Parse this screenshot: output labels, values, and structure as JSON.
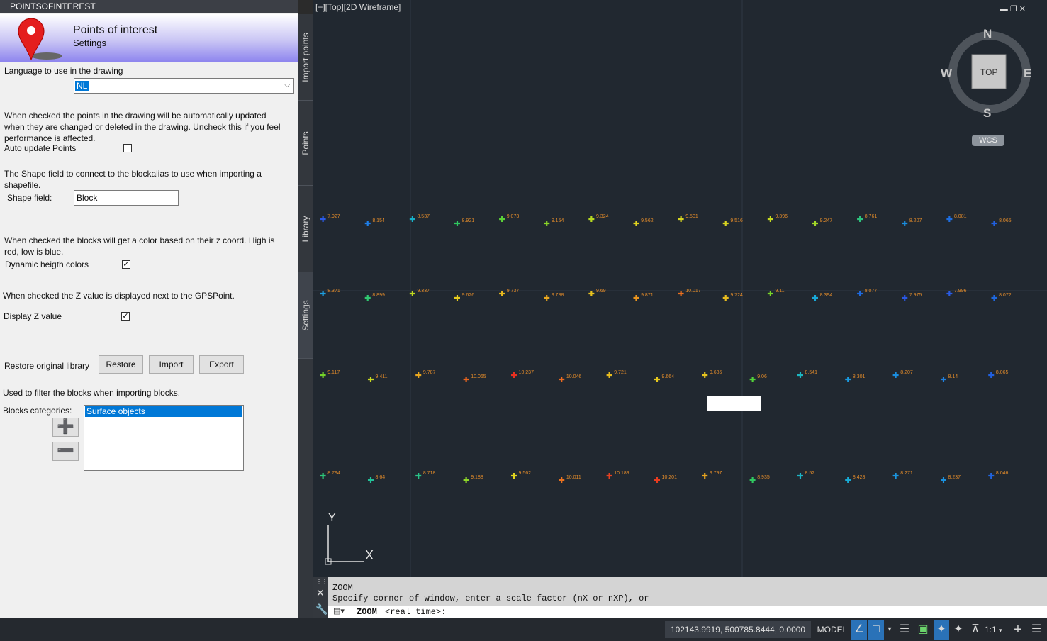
{
  "palette": {
    "title": "POINTSOFINTEREST",
    "header_title": "Points of interest",
    "header_subtitle": "Settings",
    "language_label": "Language to use in the drawing",
    "language_value": "NL",
    "auto_update_desc": "When checked the points in the drawing will be automatically updated when they are changed or deleted in the drawing. Uncheck this if you feel performance is affected.",
    "auto_update_label": "Auto update Points",
    "auto_update_checked": false,
    "shape_desc": "The Shape field to connect to the blockalias to use when importing a shapefile.",
    "shape_label": "Shape field:",
    "shape_value": "Block",
    "dyn_desc": "When checked the blocks will get a color based on their z coord. High is red, low is blue.",
    "dyn_label": "Dynamic heigth colors",
    "dyn_checked": true,
    "z_desc": "When checked the Z value is displayed next to the GPSPoint.",
    "z_label": "Display Z value",
    "z_checked": true,
    "restore_label": "Restore original library",
    "restore_btn": "Restore",
    "import_btn": "Import",
    "export_btn": "Export",
    "filter_desc": "Used to filter the blocks when importing blocks.",
    "categories_label": "Blocks categories:",
    "categories": [
      "Surface objects"
    ],
    "add_icon": "plus-icon",
    "remove_icon": "minus-icon"
  },
  "tabs": [
    "Import points",
    "Points",
    "Library",
    "Settings"
  ],
  "viewport": {
    "label": "[−][Top][2D Wireframe]",
    "viewcube": {
      "n": "N",
      "s": "S",
      "e": "E",
      "w": "W",
      "top": "TOP",
      "wcs": "WCS"
    },
    "ucs": {
      "x": "X",
      "y": "Y"
    }
  },
  "points": [
    {
      "z": "7.927",
      "c": "#2a5ae8"
    },
    {
      "z": "8.154",
      "c": "#1e7ee8"
    },
    {
      "z": "8.537",
      "c": "#17b0c8"
    },
    {
      "z": "8.921",
      "c": "#2fc860"
    },
    {
      "z": "9.073",
      "c": "#5bd238"
    },
    {
      "z": "9.154",
      "c": "#8bd828"
    },
    {
      "z": "9.324",
      "c": "#b6d820"
    },
    {
      "z": "9.562",
      "c": "#e0d41e"
    },
    {
      "z": "9.501",
      "c": "#d6d420"
    },
    {
      "z": "9.516",
      "c": "#d8d420"
    },
    {
      "z": "9.396",
      "c": "#c4d820"
    },
    {
      "z": "9.247",
      "c": "#a2d828"
    },
    {
      "z": "8.761",
      "c": "#2dc27c"
    },
    {
      "z": "8.207",
      "c": "#1a8ee0"
    },
    {
      "z": "8.081",
      "c": "#1e6ee0"
    },
    {
      "z": "8.065",
      "c": "#2060e0"
    },
    {
      "z": "8.371",
      "c": "#1ea0e0"
    },
    {
      "z": "8.899",
      "c": "#30c870"
    },
    {
      "z": "9.337",
      "c": "#c0d820"
    },
    {
      "z": "9.626",
      "c": "#e6cc1e"
    },
    {
      "z": "9.737",
      "c": "#e8b81e"
    },
    {
      "z": "9.788",
      "c": "#eaa81e"
    },
    {
      "z": "9.69",
      "c": "#e8c21e"
    },
    {
      "z": "9.871",
      "c": "#ec961e"
    },
    {
      "z": "10.017",
      "c": "#ec701e"
    },
    {
      "z": "9.724",
      "c": "#e8bc1e"
    },
    {
      "z": "9.11",
      "c": "#78d428"
    },
    {
      "z": "8.394",
      "c": "#18a8d8"
    },
    {
      "z": "8.077",
      "c": "#1e6ae0"
    },
    {
      "z": "7.975",
      "c": "#2a58e6"
    },
    {
      "z": "7.996",
      "c": "#2a5ce6"
    },
    {
      "z": "8.072",
      "c": "#1e68e0"
    },
    {
      "z": "9.117",
      "c": "#76d42a"
    },
    {
      "z": "9.411",
      "c": "#c8d820"
    },
    {
      "z": "9.787",
      "c": "#eaa81e"
    },
    {
      "z": "10.065",
      "c": "#ec661e"
    },
    {
      "z": "10.237",
      "c": "#e83020"
    },
    {
      "z": "10.046",
      "c": "#ec6a1e"
    },
    {
      "z": "9.721",
      "c": "#e8bc1e"
    },
    {
      "z": "9.664",
      "c": "#e6c81e"
    },
    {
      "z": "9.685",
      "c": "#e6c41e"
    },
    {
      "z": "9.06",
      "c": "#52d23a"
    },
    {
      "z": "8.541",
      "c": "#1cb6c0"
    },
    {
      "z": "8.301",
      "c": "#1a9ae0"
    },
    {
      "z": "8.207",
      "c": "#1a8ee0"
    },
    {
      "z": "8.14",
      "c": "#1e80e0"
    },
    {
      "z": "8.065",
      "c": "#2060e0"
    },
    {
      "z": "8.794",
      "c": "#2ec878"
    },
    {
      "z": "8.64",
      "c": "#22c098"
    },
    {
      "z": "8.718",
      "c": "#28c488"
    },
    {
      "z": "9.188",
      "c": "#8ed828"
    },
    {
      "z": "9.562",
      "c": "#e0d41e"
    },
    {
      "z": "10.011",
      "c": "#ec721e"
    },
    {
      "z": "10.189",
      "c": "#e84020"
    },
    {
      "z": "10.201",
      "c": "#e83c20"
    },
    {
      "z": "9.797",
      "c": "#eaa61e"
    },
    {
      "z": "8.935",
      "c": "#30c860"
    },
    {
      "z": "8.52",
      "c": "#1cb4c4"
    },
    {
      "z": "8.428",
      "c": "#18aad4"
    },
    {
      "z": "8.271",
      "c": "#1a96e0"
    },
    {
      "z": "8.237",
      "c": "#1a92e0"
    },
    {
      "z": "8.046",
      "c": "#2064e0"
    }
  ],
  "command": {
    "history_1": "ZOOM",
    "history_2": "Specify corner of window, enter a scale factor (nX or nXP), or",
    "prompt_cmd": "ZOOM",
    "prompt_rest": "<real time>:"
  },
  "status": {
    "coords": "102143.9919, 500785.8444, 0.0000",
    "model": "MODEL",
    "scale": "1:1"
  }
}
